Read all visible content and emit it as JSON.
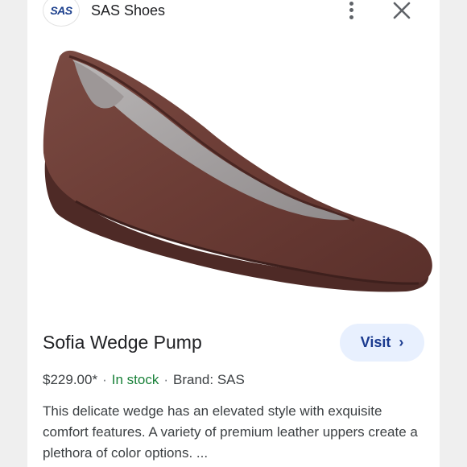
{
  "store": {
    "logo_text": "SAS",
    "name": "SAS Shoes"
  },
  "product": {
    "title": "Sofia Wedge Pump",
    "price": "$229.00*",
    "separator": "·",
    "stock_status": "In stock",
    "brand": "Brand: SAS",
    "description": "This delicate wedge has an elevated style with exquisite comfort features. A variety of premium leather uppers create a plethora of color options. ...",
    "image_icon": "wedge-pump-shoe"
  },
  "actions": {
    "visit_label": "Visit",
    "visit_icon": "chevron-right-icon",
    "more_icon": "more-vert-icon",
    "close_icon": "close-icon"
  },
  "colors": {
    "accent_button_bg": "#e8f0fe",
    "accent_button_text": "#1a3a8f",
    "stock_green": "#188038",
    "shoe_suede": "#6e3f37"
  }
}
